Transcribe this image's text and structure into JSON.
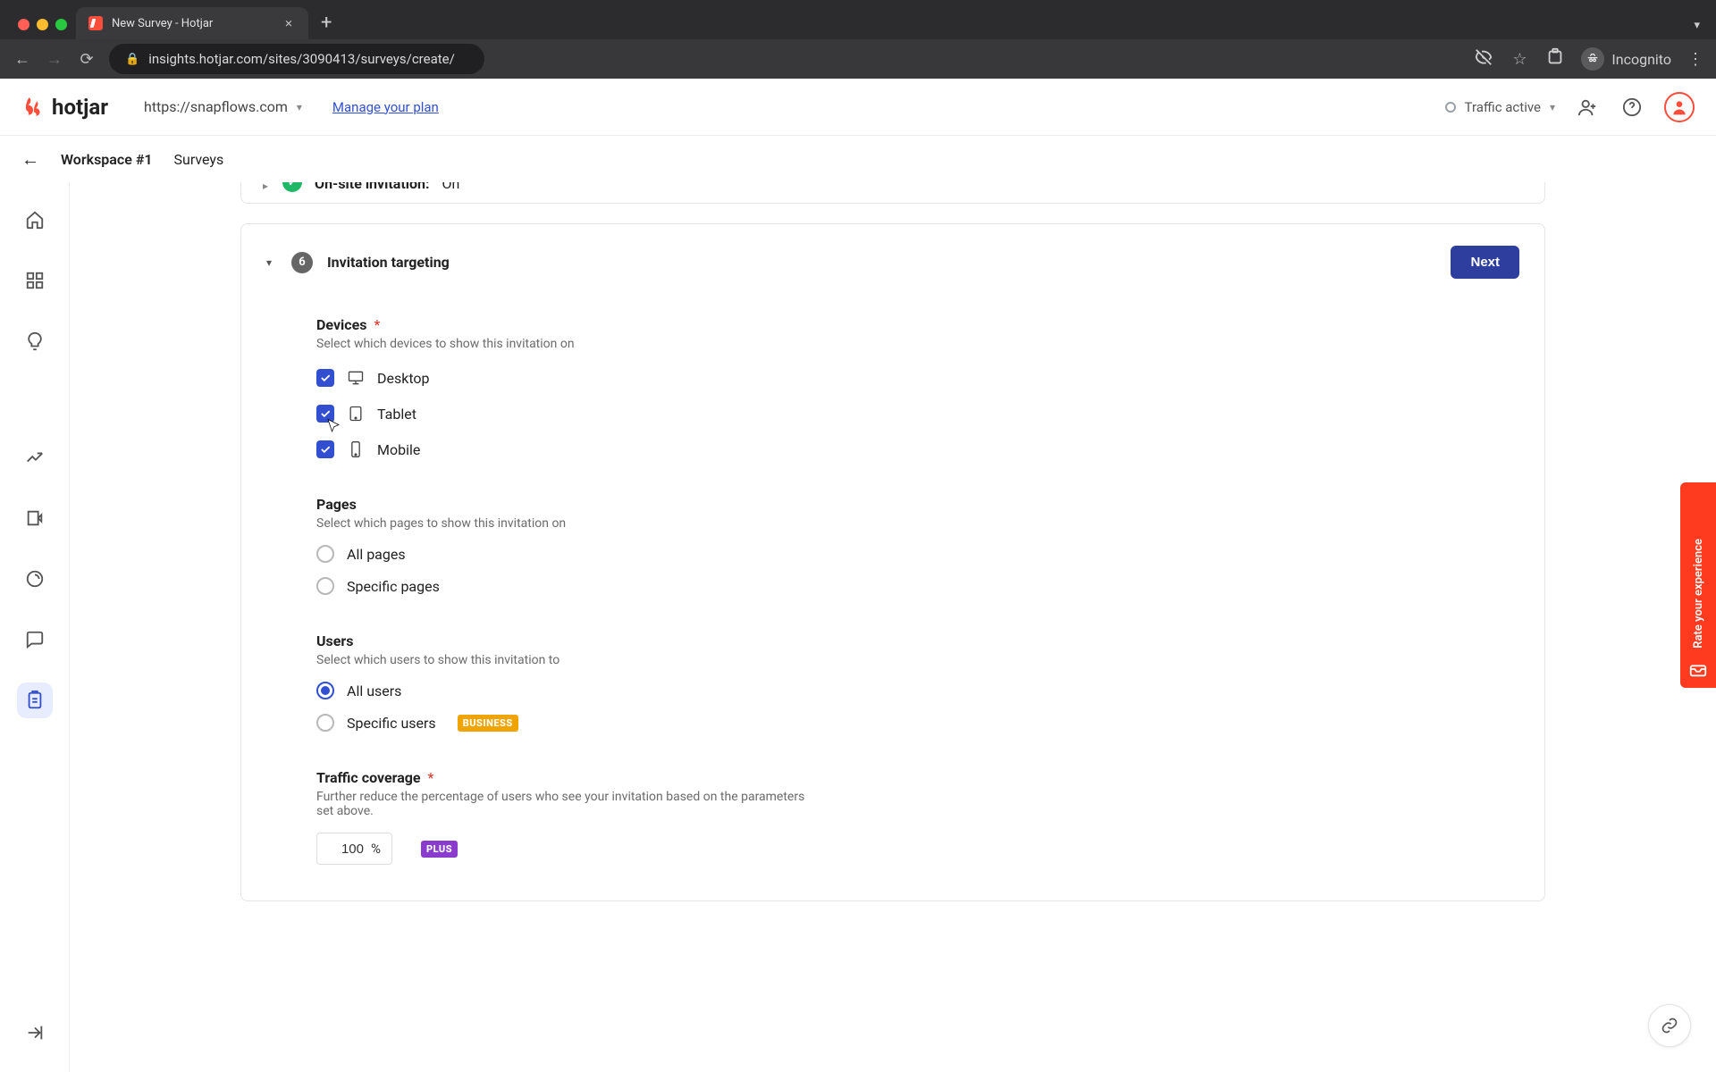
{
  "browser": {
    "tab_title": "New Survey - Hotjar",
    "url": "insights.hotjar.com/sites/3090413/surveys/create/",
    "incognito_label": "Incognito"
  },
  "header": {
    "logo_text": "hotjar",
    "site_selector": "https://snapflows.com",
    "manage_plan": "Manage your plan",
    "traffic_status": "Traffic active"
  },
  "breadcrumb": {
    "workspace": "Workspace #1",
    "section": "Surveys"
  },
  "peek_card": {
    "title_prefix": "On-site invitation:",
    "status": "On"
  },
  "card": {
    "step_number": "6",
    "title": "Invitation targeting",
    "next_button": "Next"
  },
  "devices": {
    "label": "Devices",
    "help": "Select which devices to show this invitation on",
    "items": [
      {
        "label": "Desktop",
        "checked": true
      },
      {
        "label": "Tablet",
        "checked": true
      },
      {
        "label": "Mobile",
        "checked": true
      }
    ]
  },
  "pages": {
    "label": "Pages",
    "help": "Select which pages to show this invitation on",
    "options": [
      {
        "label": "All pages",
        "selected": false
      },
      {
        "label": "Specific pages",
        "selected": false
      }
    ]
  },
  "users": {
    "label": "Users",
    "help": "Select which users to show this invitation to",
    "options": [
      {
        "label": "All users",
        "selected": true
      },
      {
        "label": "Specific users",
        "selected": false,
        "badge": "BUSINESS"
      }
    ]
  },
  "traffic": {
    "label": "Traffic coverage",
    "help": "Further reduce the percentage of users who see your invitation based on the parameters set above.",
    "value": "100",
    "unit": "%",
    "badge": "PLUS"
  },
  "rate_widget": {
    "label": "Rate your experience"
  }
}
